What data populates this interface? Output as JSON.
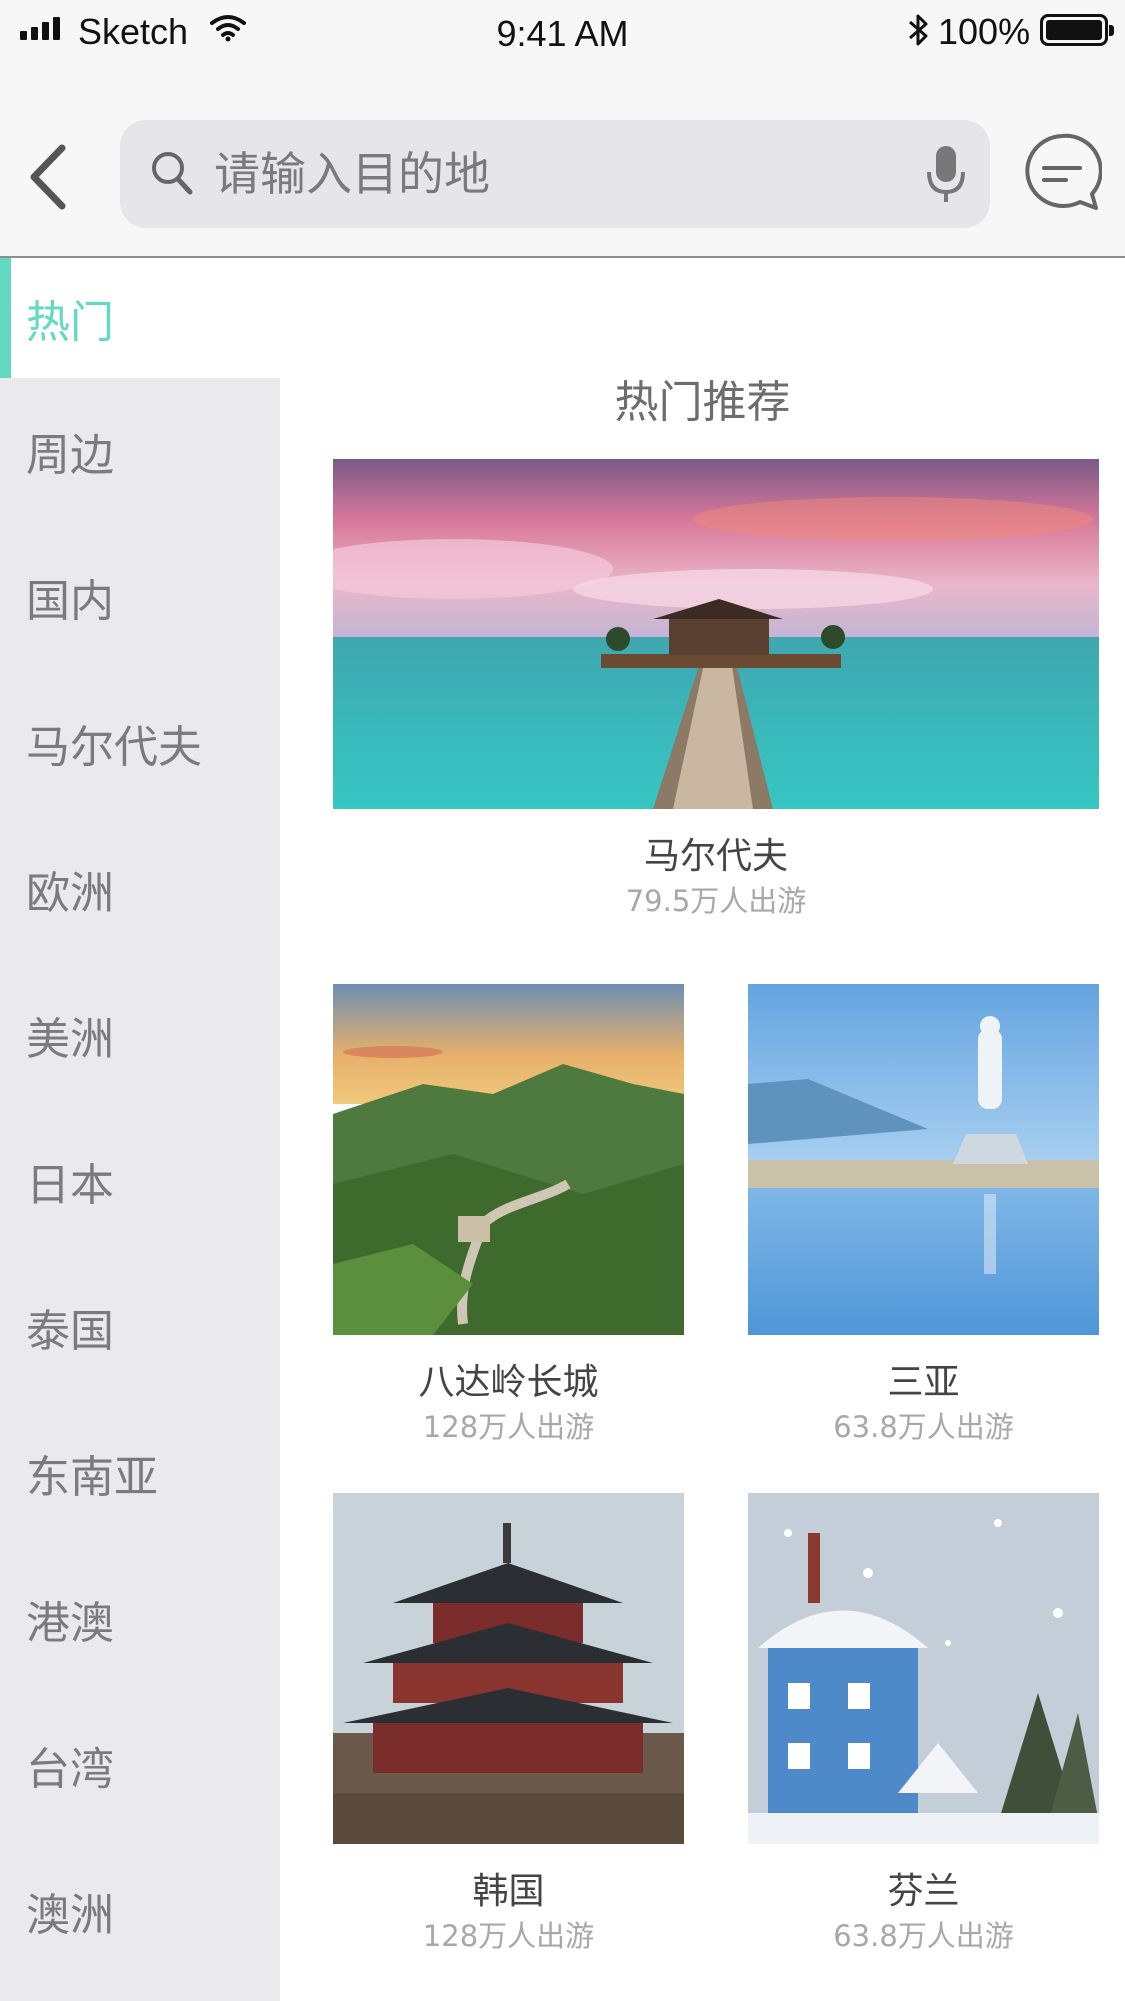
{
  "status_bar": {
    "carrier": "Sketch",
    "time": "9:41 AM",
    "battery_percent": "100%"
  },
  "nav": {
    "back_icon": "chevron-left-icon",
    "search_placeholder": "请输入目的地",
    "search_icon": "search-icon",
    "mic_icon": "microphone-icon",
    "message_icon": "message-bubble-icon"
  },
  "colors": {
    "accent": "#63d8c2",
    "sidebar_bg": "#eaeaec",
    "search_bg": "#e6e6e9"
  },
  "sidebar": {
    "items": [
      {
        "label": "热门",
        "active": true
      },
      {
        "label": "周边"
      },
      {
        "label": "国内"
      },
      {
        "label": "马尔代夫"
      },
      {
        "label": "欧洲"
      },
      {
        "label": "美洲"
      },
      {
        "label": "日本"
      },
      {
        "label": "泰国"
      },
      {
        "label": "东南亚"
      },
      {
        "label": "港澳"
      },
      {
        "label": "台湾"
      },
      {
        "label": "澳洲"
      }
    ]
  },
  "content": {
    "section_title": "热门推荐",
    "featured": {
      "name": "马尔代夫",
      "travelers": "79.5万人出游"
    },
    "grid": [
      {
        "name": "八达岭长城",
        "travelers": "128万人出游"
      },
      {
        "name": "三亚",
        "travelers": "63.8万人出游"
      },
      {
        "name": "韩国",
        "travelers": "128万人出游"
      },
      {
        "name": "芬兰",
        "travelers": "63.8万人出游"
      }
    ]
  }
}
